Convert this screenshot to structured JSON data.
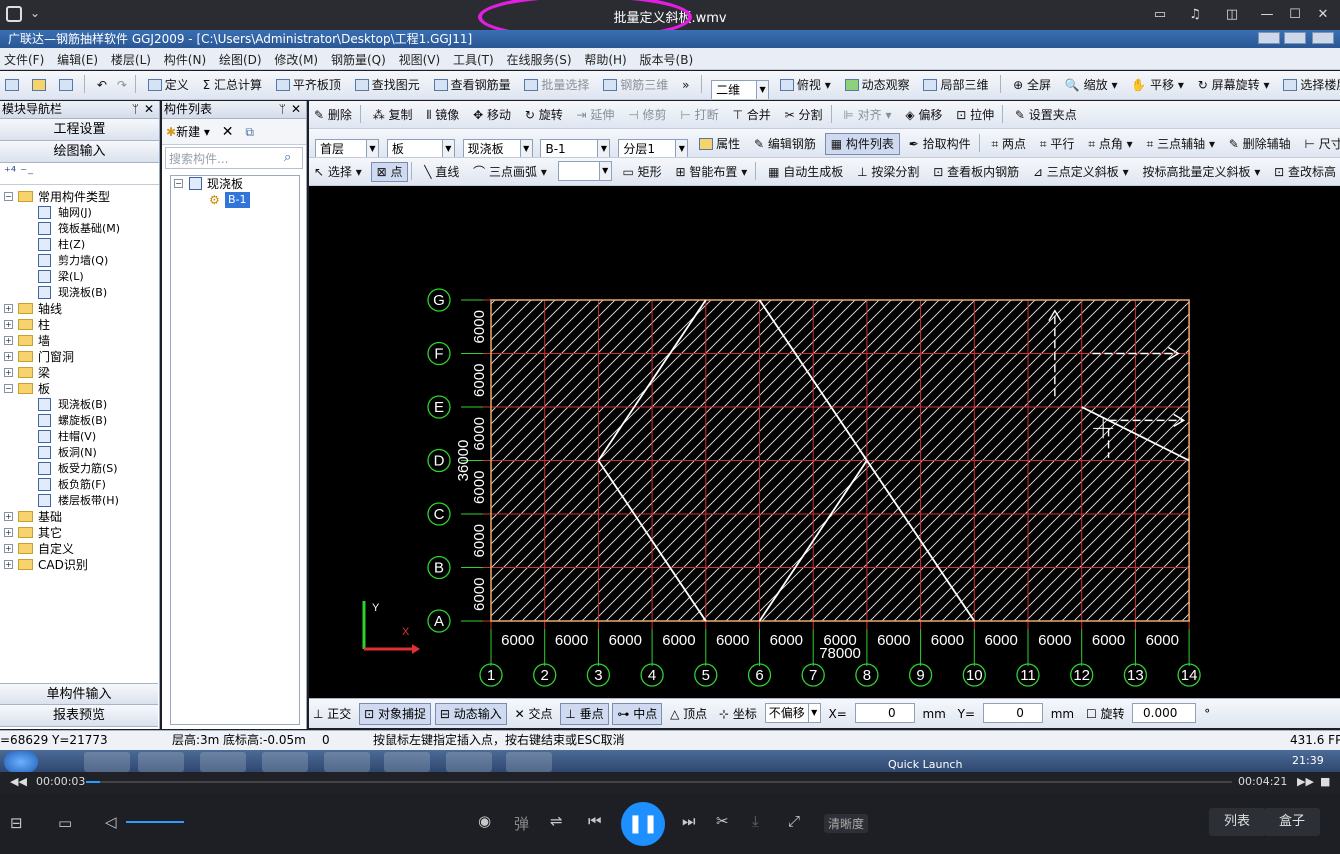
{
  "player": {
    "title": "批量定义斜板.wmv",
    "current_time": "00:00:03",
    "total_time": "00:04:21",
    "progress": 0.012,
    "clarity_label": "清晰度",
    "danmu_label": "弹",
    "list_label": "列表",
    "box_label": "盒子"
  },
  "app": {
    "title": "广联达—钢筋抽样软件 GGJ2009 - [C:\\Users\\Administrator\\Desktop\\工程1.GGJ11]",
    "menu": [
      "文件(F)",
      "编辑(E)",
      "楼层(L)",
      "构件(N)",
      "绘图(D)",
      "修改(M)",
      "钢筋量(Q)",
      "视图(V)",
      "工具(T)",
      "在线服务(S)",
      "帮助(H)",
      "版本号(B)"
    ],
    "toolbar1": {
      "define": "定义",
      "sum": "汇总计算",
      "flush_slab": "平齐板顶",
      "find_elem": "查找图元",
      "view_rebar": "查看钢筋量",
      "batch_select": "批量选择",
      "rebar_3d": "钢筋三维",
      "view_2d": "二维",
      "top_view": "俯视",
      "dynamic": "动态观察",
      "local_3d": "局部三维",
      "fullscreen": "全屏",
      "zoom": "缩放",
      "pan": "平移",
      "rotate_screen": "屏幕旋转",
      "select_floor": "选择楼层"
    },
    "toolbar2": {
      "delete": "删除",
      "copy": "复制",
      "mirror": "镜像",
      "move": "移动",
      "rotate": "旋转",
      "extend": "延伸",
      "trim": "修剪",
      "break": "打断",
      "merge": "合并",
      "split": "分割",
      "align": "对齐",
      "offset": "偏移",
      "stretch": "拉伸",
      "grip": "设置夹点"
    },
    "toolbar3": {
      "floor": "首层",
      "category": "板",
      "type": "现浇板",
      "component": "B-1",
      "layer": "分层1",
      "properties": "属性",
      "edit_rebar": "编辑钢筋",
      "component_list": "构件列表",
      "pick": "拾取构件",
      "two_points": "两点",
      "parallel": "平行",
      "point_angle": "点角",
      "three_point_aux": "三点辅轴",
      "delete_aux": "删除辅轴",
      "dim": "尺寸标注"
    },
    "toolbar4": {
      "select": "选择",
      "point": "点",
      "line": "直线",
      "arc": "三点画弧",
      "rect": "矩形",
      "smart": "智能布置",
      "auto_slab": "自动生成板",
      "beam_split": "按梁分割",
      "view_inner_rebar": "查看板内钢筋",
      "three_pt_slope": "三点定义斜板",
      "batch_slope": "按标高批量定义斜板",
      "edit_elev": "查改标高"
    },
    "nav": {
      "title": "模块导航栏",
      "project_settings": "工程设置",
      "drawing_input": "绘图输入",
      "single_input": "单构件输入",
      "report_preview": "报表预览",
      "tree": [
        {
          "label": "常用构件类型",
          "level": 0,
          "expanded": true
        },
        {
          "label": "轴网(J)",
          "level": 1
        },
        {
          "label": "筏板基础(M)",
          "level": 1
        },
        {
          "label": "柱(Z)",
          "level": 1
        },
        {
          "label": "剪力墙(Q)",
          "level": 1
        },
        {
          "label": "梁(L)",
          "level": 1
        },
        {
          "label": "现浇板(B)",
          "level": 1
        },
        {
          "label": "轴线",
          "level": 0
        },
        {
          "label": "柱",
          "level": 0
        },
        {
          "label": "墙",
          "level": 0
        },
        {
          "label": "门窗洞",
          "level": 0
        },
        {
          "label": "梁",
          "level": 0
        },
        {
          "label": "板",
          "level": 0,
          "expanded": true
        },
        {
          "label": "现浇板(B)",
          "level": 1
        },
        {
          "label": "螺旋板(B)",
          "level": 1
        },
        {
          "label": "柱帽(V)",
          "level": 1
        },
        {
          "label": "板洞(N)",
          "level": 1
        },
        {
          "label": "板受力筋(S)",
          "level": 1
        },
        {
          "label": "板负筋(F)",
          "level": 1
        },
        {
          "label": "楼层板带(H)",
          "level": 1
        },
        {
          "label": "基础",
          "level": 0
        },
        {
          "label": "其它",
          "level": 0
        },
        {
          "label": "自定义",
          "level": 0
        },
        {
          "label": "CAD识别",
          "level": 0
        }
      ]
    },
    "component_panel": {
      "title": "构件列表",
      "new_label": "新建",
      "search_placeholder": "搜索构件...",
      "tree_root": "现浇板",
      "tree_item": "B-1"
    },
    "grid": {
      "rows": [
        "G",
        "F",
        "E",
        "D",
        "C",
        "B",
        "A"
      ],
      "cols": [
        "1",
        "2",
        "3",
        "4",
        "5",
        "6",
        "7",
        "8",
        "9",
        "10",
        "11",
        "12",
        "13",
        "14"
      ],
      "span_label": "6000",
      "total_x": "78000",
      "total_y": "36000"
    },
    "axis": {
      "x": "X",
      "y": "Y"
    },
    "snapbar": {
      "ortho": "正交",
      "object_snap": "对象捕捉",
      "dynamic_input": "动态输入",
      "intersection": "交点",
      "perpendicular": "垂点",
      "midpoint": "中点",
      "vertex": "顶点",
      "coord": "坐标",
      "offset_mode": "不偏移",
      "x_label": "X=",
      "x_value": "0",
      "y_label": "Y=",
      "y_value": "0",
      "unit": "mm",
      "rotate": "旋转",
      "rotate_value": "0.000",
      "degree": "°"
    },
    "status": {
      "coords": "=68629 Y=21773",
      "floor_height": "层高:3m",
      "bottom_elev": "底标高:-0.05m",
      "zero": "0",
      "hint": "按鼠标左键指定插入点，按右键结束或ESC取消",
      "fps": "431.6 FPS"
    },
    "taskbar": {
      "quick_launch": "Quick Launch",
      "time": "21:39"
    }
  }
}
